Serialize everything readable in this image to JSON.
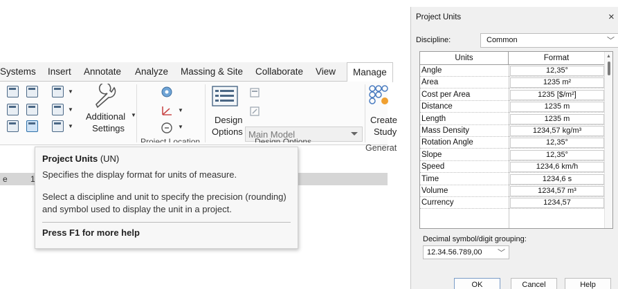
{
  "ribbon": {
    "tabs": [
      "Systems",
      "Insert",
      "Annotate",
      "Analyze",
      "Massing & Site",
      "Collaborate",
      "View",
      "Manage"
    ],
    "active_tab": "Manage",
    "additional_settings": [
      "Additional",
      "Settings"
    ],
    "design_options": [
      "Design",
      "Options"
    ],
    "main_model": "Main Model",
    "create_study": [
      "Create",
      "Study"
    ],
    "panel_labels": [
      "Project Location",
      "Design Options",
      "Generat"
    ],
    "below_bar": [
      "e",
      "1"
    ]
  },
  "tooltip": {
    "title": "Project Units",
    "shortcut": "(UN)",
    "summary": "Specifies the display format for units of measure.",
    "detail": "Select a discipline and unit to specify the precision (rounding) and symbol used to display the unit in a project.",
    "help": "Press F1 for more help"
  },
  "dialog": {
    "title": "Project Units",
    "close": "×",
    "discipline_label": "Discipline:",
    "discipline_value": "Common",
    "columns": [
      "Units",
      "Format"
    ],
    "rows": [
      {
        "unit": "Angle",
        "format": "12,35°"
      },
      {
        "unit": "Area",
        "format": "1235 m²"
      },
      {
        "unit": "Cost per Area",
        "format": "1235 [$/m²]"
      },
      {
        "unit": "Distance",
        "format": "1235 m"
      },
      {
        "unit": "Length",
        "format": "1235 m"
      },
      {
        "unit": "Mass Density",
        "format": "1234,57 kg/m³"
      },
      {
        "unit": "Rotation Angle",
        "format": "12,35°"
      },
      {
        "unit": "Slope",
        "format": "12,35°"
      },
      {
        "unit": "Speed",
        "format": "1234,6 km/h"
      },
      {
        "unit": "Time",
        "format": "1234,6 s"
      },
      {
        "unit": "Volume",
        "format": "1234,57 m³"
      },
      {
        "unit": "Currency",
        "format": "1234,57"
      }
    ],
    "decimal_label": "Decimal symbol/digit grouping:",
    "decimal_value": "12.34.56.789,00",
    "ok": "OK",
    "cancel": "Cancel",
    "help": "Help"
  }
}
